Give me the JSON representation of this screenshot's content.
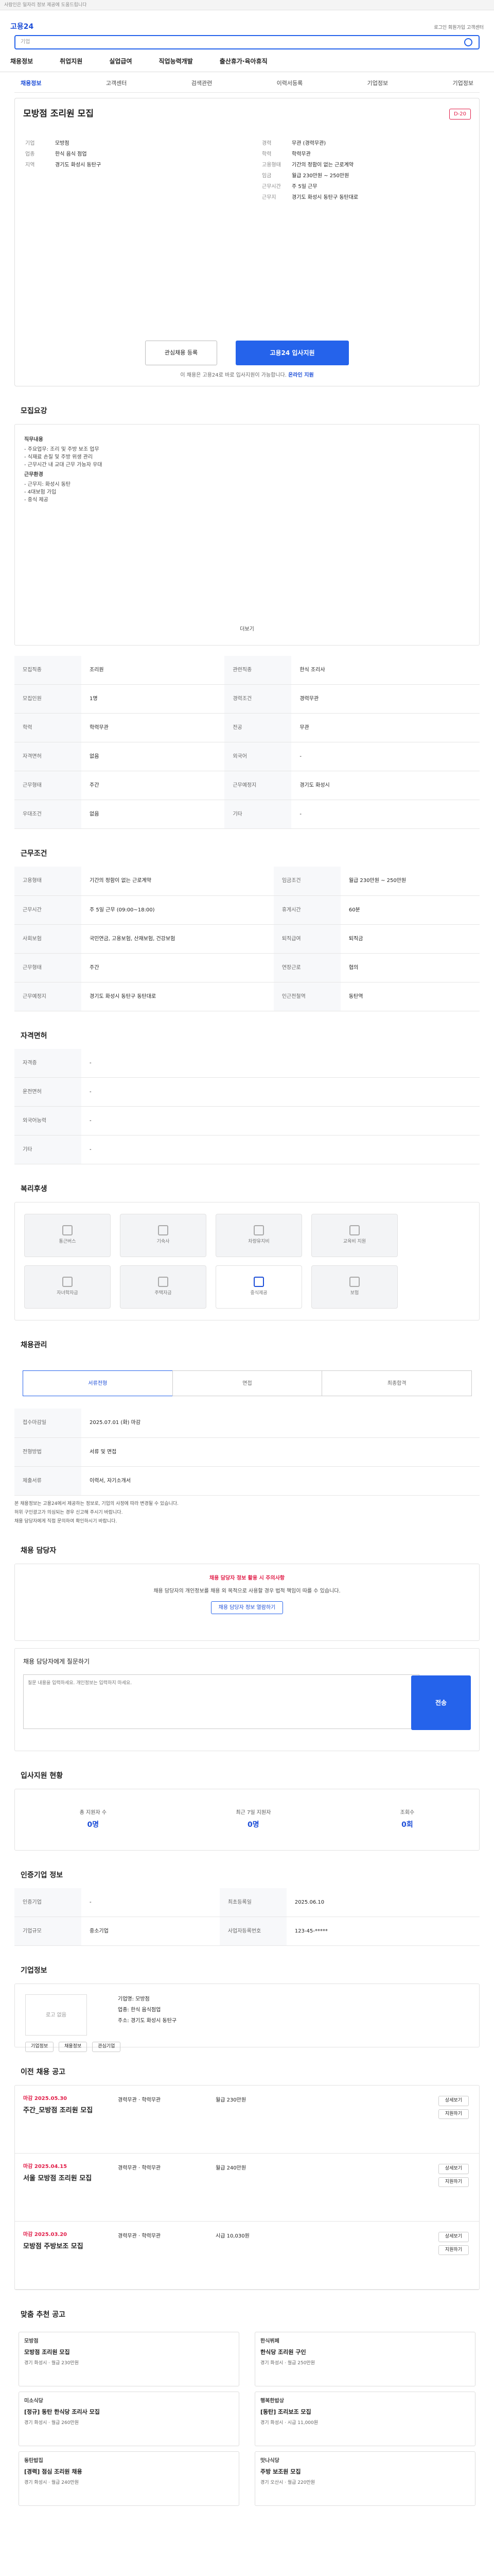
{
  "topbar": {
    "notice": "사람인은 일자리 정보 제공에 도움드립니다"
  },
  "header": {
    "logo": "고용24",
    "search_placeholder": "기업",
    "util": "로그인  회원가입  고객센터",
    "gnb": [
      "채용정보",
      "취업지원",
      "실업급여",
      "직업능력개발",
      "출산휴가·육아휴직"
    ]
  },
  "tabs": [
    "채용정보",
    "고객센터",
    "검색관련",
    "이력서등록",
    "기업정보",
    "기업정보"
  ],
  "job": {
    "title": "모방점 조리원 모집",
    "badge": "D-20",
    "left": [
      {
        "k": "기업",
        "v": "모방점"
      },
      {
        "k": "업종",
        "v": "한식 음식 점업"
      },
      {
        "k": "지역",
        "v": "경기도 화성시 동탄구"
      }
    ],
    "right": [
      {
        "k": "경력",
        "v": "무관 (경력무관)"
      },
      {
        "k": "학력",
        "v": "학력무관"
      },
      {
        "k": "고용형태",
        "v": "기간의 정함이 없는 근로계약"
      },
      {
        "k": "임금",
        "v": "월급 230만원 ~ 250만원"
      },
      {
        "k": "근무시간",
        "v": "주 5일 근무"
      },
      {
        "k": "근무지",
        "v": "경기도 화성시 동탄구 동탄대로"
      }
    ],
    "btn_fav": "관심채용 등록",
    "btn_apply": "고용24 입사지원",
    "tip_pre": "이 채용은 고용24로 바로 입사지원이 가능합니다.",
    "tip_link": "온라인 지원"
  },
  "sections": {
    "detail": "모집요강",
    "conditions": "근무조건",
    "welfare": "복리후생",
    "qual": "자격면허",
    "etc": "기타사항",
    "manage": "채용관리",
    "ask": "채용 담당자",
    "stat": "입사지원 현황",
    "info": "인증기업 정보",
    "company": "기업정보",
    "past": "이전 채용 공고",
    "recommend": "맞춤 추천 공고"
  },
  "desc": {
    "h1": "직무내용",
    "lines": [
      "- 주요업무: 조리 및 주방 보조 업무",
      "- 식재료 손질 및 주방 위생 관리",
      "- 근무시간 내 교대 근무 가능자 우대"
    ],
    "h2": "근무환경",
    "lines2": [
      "- 근무지: 화성시 동탄",
      "- 4대보험 가입",
      "- 중식 제공"
    ],
    "more": "더보기"
  },
  "detail_table": [
    [
      "모집직종",
      "조리원",
      "관련직종",
      "한식 조리사"
    ],
    [
      "모집인원",
      "1명",
      "경력조건",
      "경력무관"
    ],
    [
      "학력",
      "학력무관",
      "전공",
      "무관"
    ],
    [
      "자격면허",
      "없음",
      "외국어",
      "-"
    ],
    [
      "근무형태",
      "주간",
      "근무예정지",
      "경기도 화성시"
    ],
    [
      "우대조건",
      "없음",
      "기타",
      "-"
    ]
  ],
  "cond_table": [
    [
      "고용형태",
      "기간의 정함이 없는 근로계약",
      "임금조건",
      "월급 230만원 ~ 250만원"
    ],
    [
      "근무시간",
      "주 5일 근무 (09:00~18:00)",
      "휴게시간",
      "60분"
    ],
    [
      "사회보험",
      "국민연금, 고용보험, 산재보험, 건강보험",
      "퇴직급여",
      "퇴직금"
    ],
    [
      "근무형태",
      "주간",
      "연장근로",
      "협의"
    ],
    [
      "근무예정지",
      "경기도 화성시 동탄구 동탄대로",
      "인근전철역",
      "동탄역"
    ]
  ],
  "welfare": [
    "통근버스",
    "기숙사",
    "차량유지비",
    "교육비 지원",
    "자녀학자금",
    "주택자금",
    "중식제공",
    "보험"
  ],
  "welfare_on": [
    6
  ],
  "qual_rows": [
    [
      "자격증",
      "-"
    ],
    [
      "운전면허",
      "-"
    ],
    [
      "외국어능력",
      "-"
    ],
    [
      "기타",
      "-"
    ]
  ],
  "manage": {
    "steps": [
      "서류전형",
      "면접",
      "최종합격"
    ],
    "rows": [
      [
        "접수마감일",
        "2025.07.01 (화) 마감"
      ],
      [
        "전형방법",
        "서류 및 면접"
      ],
      [
        "제출서류",
        "이력서, 자기소개서"
      ]
    ]
  },
  "bullets": [
    "본 채용정보는 고용24에서 제공하는 정보로, 기업의 사정에 따라 변경될 수 있습니다.",
    "허위 구인광고가 의심되는 경우 신고해 주시기 바랍니다.",
    "채용 담당자에게 직접 문의하여 확인하시기 바랍니다."
  ],
  "alert": {
    "title": "채용 담당자 정보 활용 시 주의사항",
    "body": "채용 담당자의 개인정보를 채용 외 목적으로 사용할 경우 법적 책임이 따를 수 있습니다.",
    "btn": "채용 담당자 정보 열람하기"
  },
  "ask": {
    "label": "채용 담당자에게 질문하기",
    "placeholder": "질문 내용을 입력하세요. 개인정보는 입력하지 마세요.",
    "send": "전송"
  },
  "stats": [
    {
      "k": "총 지원자 수",
      "v": "0명"
    },
    {
      "k": "최근 7일 지원자",
      "v": "0명"
    },
    {
      "k": "조회수",
      "v": "0회"
    }
  ],
  "info_table": [
    [
      "인증기업",
      "-",
      "최초등록일",
      "2025.06.10"
    ],
    [
      "기업규모",
      "중소기업",
      "사업자등록번호",
      "123-45-*****"
    ]
  ],
  "company": {
    "logo": "로고 없음",
    "rows": [
      "기업명: 모방점",
      "업종: 한식 음식점업",
      "주소: 경기도 화성시 동탄구"
    ],
    "btns": [
      "기업정보",
      "채용정보",
      "관심기업"
    ]
  },
  "past": [
    {
      "date": "마감 2025.05.30",
      "title": "주간_모방점 조리원 모집",
      "m1": "경력무관 · 학력무관",
      "m2": "월급 230만원",
      "act": [
        "상세보기",
        "지원하기"
      ]
    },
    {
      "date": "마감 2025.04.15",
      "title": "서울 모방점 조리원 모집",
      "m1": "경력무관 · 학력무관",
      "m2": "월급 240만원",
      "act": [
        "상세보기",
        "지원하기"
      ]
    },
    {
      "date": "마감 2025.03.20",
      "title": "모방점 주방보조 모집",
      "m1": "경력무관 · 학력무관",
      "m2": "시급 10,030원",
      "act": [
        "상세보기",
        "지원하기"
      ]
    }
  ],
  "recommend": [
    {
      "n": "모방점",
      "t": "모방점 조리원 모집",
      "s": "경기 화성시 · 월급 230만원"
    },
    {
      "n": "한식뷔페",
      "t": "한식당 조리원 구인",
      "s": "경기 화성시 · 월급 250만원"
    },
    {
      "n": "미소식당",
      "t": "[정규] 동탄 한식당 조리사 모집",
      "s": "경기 화성시 · 월급 260만원"
    },
    {
      "n": "행복한밥상",
      "t": "[동탄] 조리보조 모집",
      "s": "경기 화성시 · 시급 11,000원"
    },
    {
      "n": "동탄밥집",
      "t": "[경력] 점심 조리원 채용",
      "s": "경기 화성시 · 월급 240만원"
    },
    {
      "n": "맛나식당",
      "t": "주방 보조원 모집",
      "s": "경기 오산시 · 월급 220만원"
    }
  ]
}
